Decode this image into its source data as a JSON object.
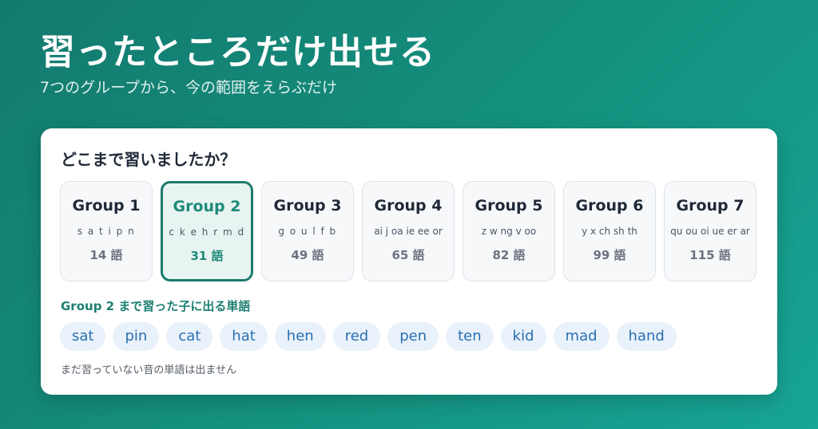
{
  "hero": {
    "title": "習ったところだけ出せる",
    "subtitle": "7つのグループから、今の範囲をえらぶだけ"
  },
  "card": {
    "heading": "どこまで習いましたか？",
    "selected_group": 2,
    "groups": [
      {
        "name": "Group 1",
        "letters": "s a t i p n",
        "count": "14 語"
      },
      {
        "name": "Group 2",
        "letters": "c k e h r m d",
        "count": "31 語"
      },
      {
        "name": "Group 3",
        "letters": "g o u l f b",
        "count": "49 語"
      },
      {
        "name": "Group 4",
        "letters": "ai j oa ie ee or",
        "count": "65 語"
      },
      {
        "name": "Group 5",
        "letters": "z w ng v oo",
        "count": "82 語"
      },
      {
        "name": "Group 6",
        "letters": "y x ch sh th",
        "count": "99 語"
      },
      {
        "name": "Group 7",
        "letters": "qu ou oi ue er ar",
        "count": "115 語"
      }
    ],
    "words_heading": "Group 2 まで習った子に出る単語",
    "words": [
      "sat",
      "pin",
      "cat",
      "hat",
      "hen",
      "red",
      "pen",
      "ten",
      "kid",
      "mad",
      "hand"
    ],
    "note": "まだ習っていない音の単語は出ません"
  },
  "colors": {
    "accent": "#1d7a6c",
    "chip_background": "#e9f2fb",
    "chip_text": "#2a6fb0",
    "page_background": "#14917f"
  }
}
